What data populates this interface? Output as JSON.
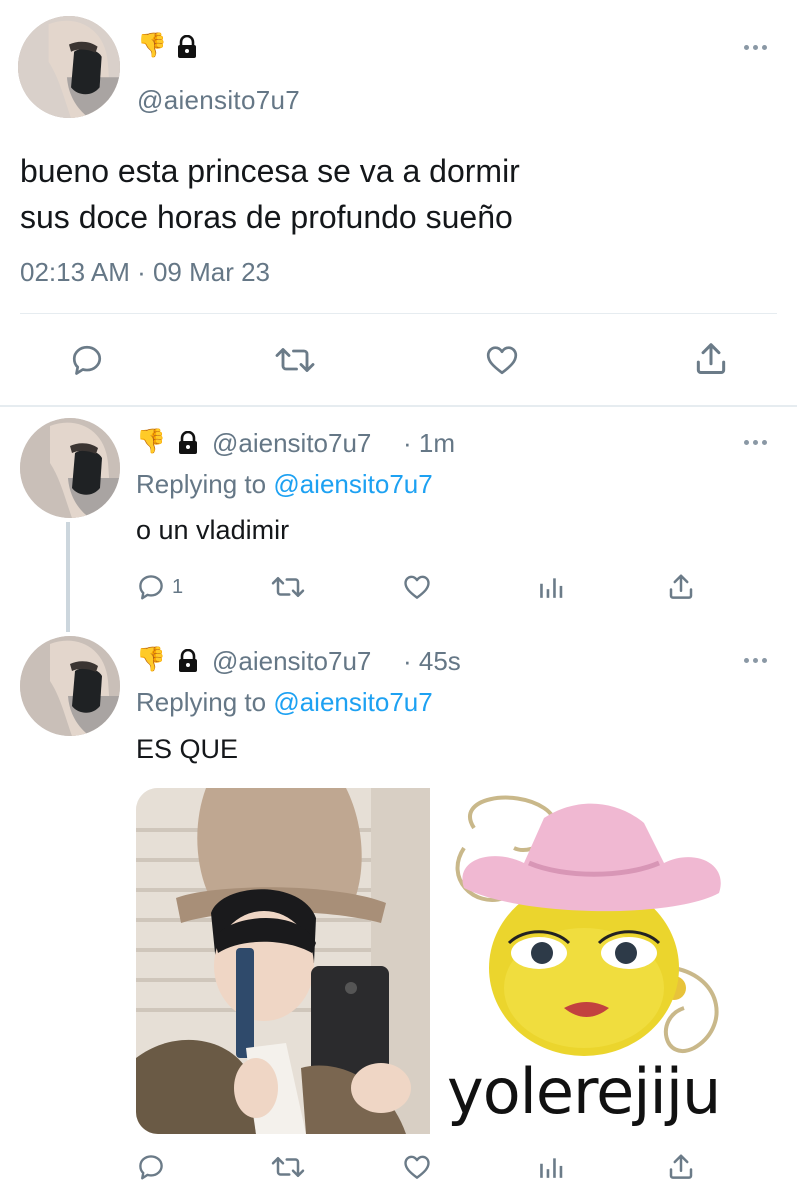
{
  "main_tweet": {
    "handle": "@aiensito7u7",
    "text_line1": "bueno esta princesa se va a dormir",
    "text_line2": "sus doce horas de profundo sueño",
    "timestamp": "02:13 AM · 09 Mar 23",
    "icons": [
      "reply-icon",
      "retweet-icon",
      "like-icon",
      "share-icon"
    ]
  },
  "replies": [
    {
      "handle": "@aiensito7u7",
      "time": "· 1m",
      "replying_prefix": "Replying to",
      "replying_handle": "@aiensito7u7",
      "text": "o un vladimir",
      "reply_count": "1"
    },
    {
      "handle": "@aiensito7u7",
      "time": "· 45s",
      "replying_prefix": "Replying to",
      "replying_handle": "@aiensito7u7",
      "text": "ES QUE",
      "reply_count": "",
      "media_caption": "yolerejiju"
    }
  ],
  "colors": {
    "accent": "#1da1f2",
    "secondary_text": "#657786",
    "icon": "#6b7b88",
    "divider": "#e6ecf0"
  }
}
